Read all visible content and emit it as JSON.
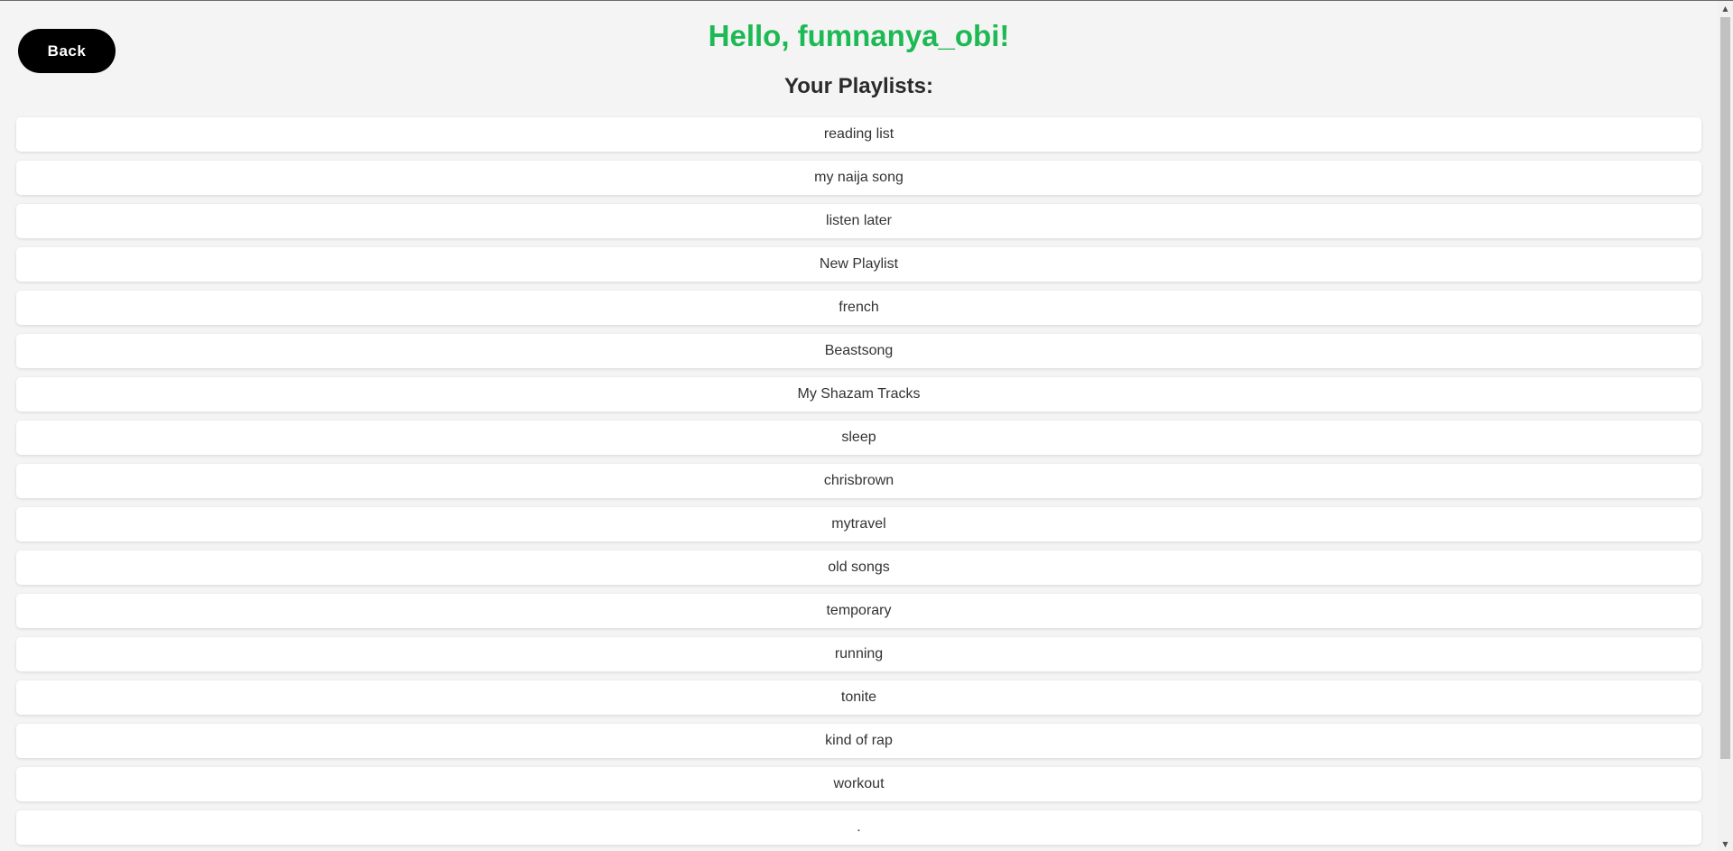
{
  "header": {
    "back_label": "Back",
    "greeting": "Hello, fumnanya_obi!",
    "subtitle": "Your Playlists:"
  },
  "playlists": [
    "reading list",
    "my naija song",
    "listen later",
    "New Playlist",
    "french",
    "Beastsong",
    "My Shazam Tracks",
    "sleep",
    "chrisbrown",
    "mytravel",
    "old songs",
    "temporary",
    "running",
    "tonite",
    "kind of rap",
    "workout",
    "."
  ],
  "colors": {
    "greeting": "#1db954",
    "background": "#f4f4f4",
    "button": "#000000"
  },
  "icons": {
    "scroll_up": "scroll-up-arrow-icon",
    "scroll_down": "scroll-down-arrow-icon"
  }
}
